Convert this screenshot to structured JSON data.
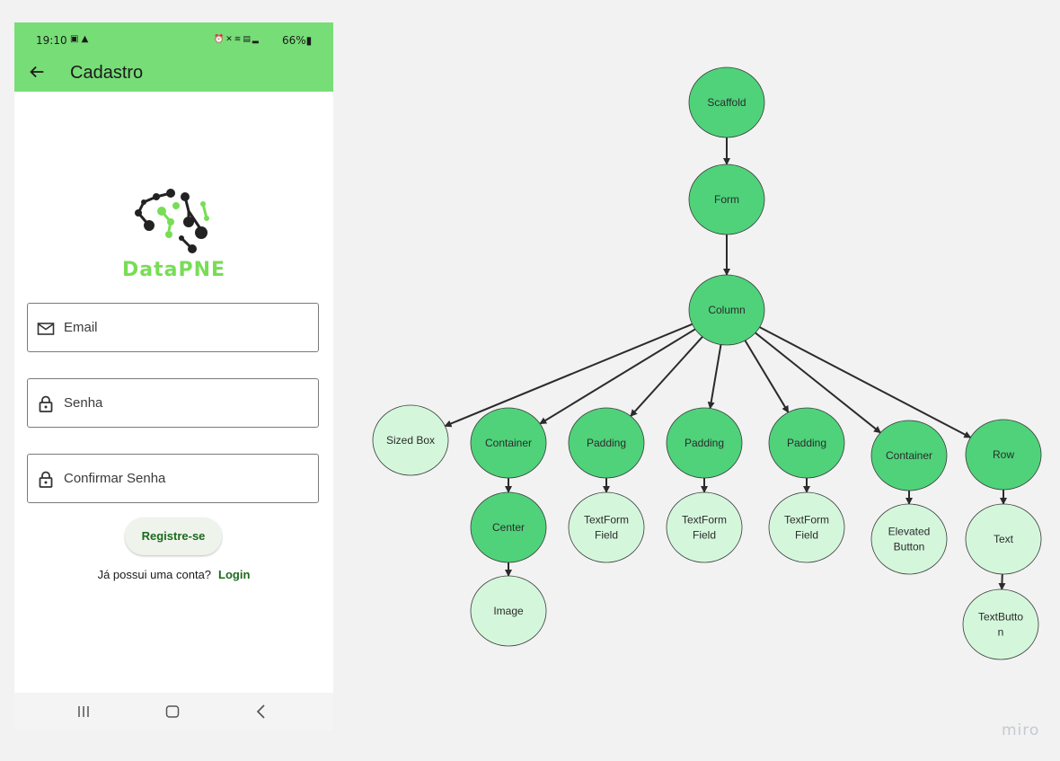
{
  "status_bar": {
    "time": "19:10",
    "left_icons": [
      "photo-icon",
      "warning-icon"
    ],
    "right_icons": [
      "alarm-icon",
      "mute-icon",
      "wifi-icon",
      "volte-icon",
      "signal-icon"
    ],
    "battery": "66%"
  },
  "app_bar": {
    "title": "Cadastro"
  },
  "logo": {
    "text": "DataPNE"
  },
  "form": {
    "email_placeholder": "Email",
    "password_placeholder": "Senha",
    "confirm_password_placeholder": "Confirmar Senha",
    "register_label": "Registre-se",
    "login_prompt": "Já possui uma conta?",
    "login_link": "Login"
  },
  "nav_bar": {
    "icons": [
      "recent-apps-icon",
      "home-icon",
      "back-icon"
    ]
  },
  "colors": {
    "app_green": "#77dd77",
    "node_dark": "#4fd27a",
    "node_light": "#d4f7dc",
    "brand_green": "#77dd55",
    "link_green": "#1c6a1c"
  },
  "widget_tree": {
    "nodes": [
      {
        "id": "scaffold",
        "label": "Scaffold",
        "shade": "dark"
      },
      {
        "id": "form",
        "label": "Form",
        "shade": "dark"
      },
      {
        "id": "column",
        "label": "Column",
        "shade": "dark"
      },
      {
        "id": "sizedbox",
        "label": "Sized Box",
        "shade": "light"
      },
      {
        "id": "container1",
        "label": "Container",
        "shade": "dark"
      },
      {
        "id": "padding1",
        "label": "Padding",
        "shade": "dark"
      },
      {
        "id": "padding2",
        "label": "Padding",
        "shade": "dark"
      },
      {
        "id": "padding3",
        "label": "Padding",
        "shade": "dark"
      },
      {
        "id": "container2",
        "label": "Container",
        "shade": "dark"
      },
      {
        "id": "row",
        "label": "Row",
        "shade": "dark"
      },
      {
        "id": "center",
        "label": "Center",
        "shade": "dark"
      },
      {
        "id": "image",
        "label": "Image",
        "shade": "light"
      },
      {
        "id": "tff1",
        "label": "TextForm Field",
        "shade": "light"
      },
      {
        "id": "tff2",
        "label": "TextForm Field",
        "shade": "light"
      },
      {
        "id": "tff3",
        "label": "TextForm Field",
        "shade": "light"
      },
      {
        "id": "elevated",
        "label": "Elevated Button",
        "shade": "light"
      },
      {
        "id": "text",
        "label": "Text",
        "shade": "light"
      },
      {
        "id": "textbutton",
        "label": "TextButto n",
        "shade": "light"
      }
    ],
    "edges": [
      [
        "scaffold",
        "form"
      ],
      [
        "form",
        "column"
      ],
      [
        "column",
        "sizedbox"
      ],
      [
        "column",
        "container1"
      ],
      [
        "column",
        "padding1"
      ],
      [
        "column",
        "padding2"
      ],
      [
        "column",
        "padding3"
      ],
      [
        "column",
        "container2"
      ],
      [
        "column",
        "row"
      ],
      [
        "container1",
        "center"
      ],
      [
        "center",
        "image"
      ],
      [
        "padding1",
        "tff1"
      ],
      [
        "padding2",
        "tff2"
      ],
      [
        "padding3",
        "tff3"
      ],
      [
        "container2",
        "elevated"
      ],
      [
        "row",
        "text"
      ],
      [
        "text",
        "textbutton"
      ]
    ]
  },
  "watermark": "miro"
}
